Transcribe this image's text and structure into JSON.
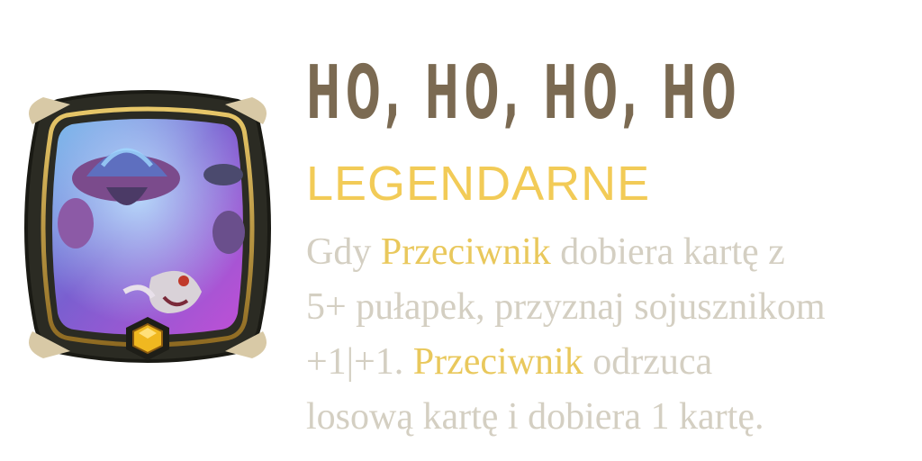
{
  "title": "HO, HO, HO, HO",
  "rarity": "LEGENDARNE",
  "colors": {
    "title": "#7b6a52",
    "rarity": "#f2cb57",
    "text": "#d4cfc2",
    "keyword": "#e9c85c",
    "frame_dark": "#2a2a22",
    "frame_gold": "#c9a23a",
    "gem": "#f0b820"
  },
  "emblem": {
    "icon": "legendary-augment-emblem-icon",
    "gem_icon": "hexagon-gem-icon"
  },
  "description": {
    "line1": {
      "a": "Gdy ",
      "keyword": "Przeciwnik",
      "b": " dobiera kartę z"
    },
    "line2": {
      "a": "5+ pułapek, przyznaj sojusznikom"
    },
    "line3": {
      "a": "+1|+1. ",
      "keyword": "Przeciwnik",
      "b": " odrzuca"
    },
    "line4": {
      "a": "losową kartę i dobiera 1 kartę."
    }
  }
}
